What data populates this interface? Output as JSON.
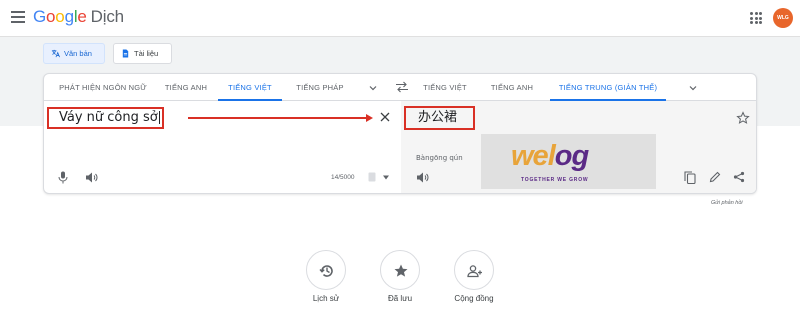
{
  "header": {
    "logo_letters": [
      "G",
      "o",
      "o",
      "g",
      "l",
      "e"
    ],
    "product_name": "Dịch",
    "avatar_text": "WLG",
    "icons": {
      "menu": "hamburger-menu-icon",
      "apps": "apps-grid-icon"
    }
  },
  "mode_buttons": [
    {
      "label": "Văn bản",
      "active": true,
      "icon": "translate-icon"
    },
    {
      "label": "Tài liệu",
      "active": false,
      "icon": "document-icon"
    }
  ],
  "source_tabs": [
    {
      "label": "PHÁT HIỆN NGÔN NGỮ",
      "active": false
    },
    {
      "label": "TIẾNG ANH",
      "active": false
    },
    {
      "label": "TIẾNG VIỆT",
      "active": true
    },
    {
      "label": "TIẾNG PHÁP",
      "active": false
    }
  ],
  "target_tabs": [
    {
      "label": "TIẾNG VIỆT",
      "active": false
    },
    {
      "label": "TIẾNG ANH",
      "active": false
    },
    {
      "label": "TIẾNG TRUNG (GIẢN THỂ)",
      "active": true
    }
  ],
  "source": {
    "text": "Váy nữ công sở",
    "char_count": "14/5000"
  },
  "target": {
    "text": "办公裙",
    "romanization": "Bàngōng qún"
  },
  "ad": {
    "brand_pre": "we",
    "brand_o": "l",
    "brand_post": "og",
    "tagline": "TOGETHER WE GROW"
  },
  "feedback_label": "Gửi phản hồi",
  "bottom_actions": [
    {
      "label": "Lịch sử",
      "icon": "history-icon"
    },
    {
      "label": "Đã lưu",
      "icon": "star-filled-icon"
    },
    {
      "label": "Cộng đồng",
      "icon": "community-icon"
    }
  ],
  "colors": {
    "accent": "#1a73e8",
    "highlight_red": "#d93025",
    "brand_orange": "#e8a43a",
    "brand_purple": "#5b2a86"
  }
}
